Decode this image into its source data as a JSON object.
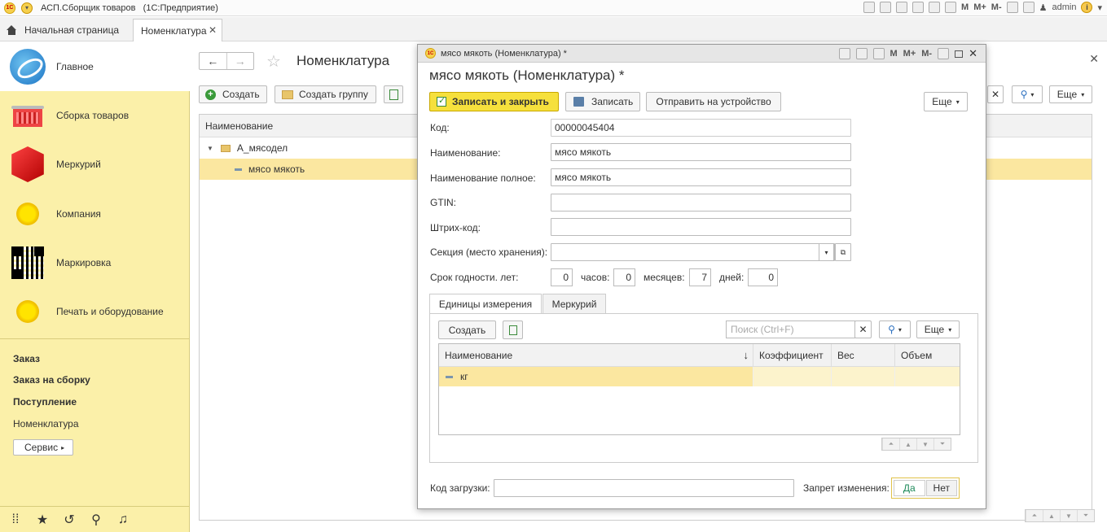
{
  "app": {
    "title": "АСП.Сборщик товаров   (1С:Предприятие)",
    "user": "admin",
    "tool_m": "M",
    "tool_mplus": "M+",
    "tool_mminus": "M-"
  },
  "tabs": {
    "home": "Начальная страница",
    "active": "Номенклатура"
  },
  "sidebar": {
    "sections": [
      {
        "label": "Главное",
        "icon": "globe-icon"
      },
      {
        "label": "Сборка товаров",
        "icon": "basket-icon"
      },
      {
        "label": "Меркурий",
        "icon": "cube-icon"
      },
      {
        "label": "Компания",
        "icon": "circle-icon"
      },
      {
        "label": "Маркировка",
        "icon": "qr-icon"
      },
      {
        "label": "Печать и оборудование",
        "icon": "circle-icon"
      }
    ],
    "links": [
      "Заказ",
      "Заказ на сборку",
      "Поступление",
      "Номенклатура"
    ],
    "service": "Сервис"
  },
  "list": {
    "title": "Номенклатура",
    "create": "Создать",
    "create_group": "Создать группу",
    "more": "Еще",
    "column": "Наименование",
    "group_row": "А_мясодел",
    "item_row": "мясо мякоть"
  },
  "dialog": {
    "window_title": "мясо мякоть (Номенклатура) *",
    "heading": "мясо мякоть (Номенклатура) *",
    "save_close": "Записать и закрыть",
    "save": "Записать",
    "send": "Отправить на устройство",
    "more": "Еще",
    "fields": {
      "code_label": "Код:",
      "code": "00000045404",
      "name_label": "Наименование:",
      "name": "мясо мякоть",
      "fullname_label": "Наименование полное:",
      "fullname": "мясо мякоть",
      "gtin_label": "GTIN:",
      "gtin": "",
      "barcode_label": "Штрих-код:",
      "barcode": "",
      "section_label": "Секция (место хранения):",
      "section": ""
    },
    "shelf": {
      "label": "Срок годности. лет:",
      "years": "0",
      "hours_label": "часов:",
      "hours": "0",
      "months_label": "месяцев:",
      "months": "7",
      "days_label": "дней:",
      "days": "0"
    },
    "tabs": [
      "Единицы измерения",
      "Меркурий"
    ],
    "units": {
      "create": "Создать",
      "search_placeholder": "Поиск (Ctrl+F)",
      "more": "Еще",
      "columns": [
        "Наименование",
        "Коэффициент",
        "Вес",
        "Объем"
      ],
      "rows": [
        {
          "name": "кг",
          "coef": "",
          "weight": "",
          "volume": ""
        }
      ]
    },
    "load_code_label": "Код загрузки:",
    "load_code": "",
    "lock_label": "Запрет изменения:",
    "lock_yes": "Да",
    "lock_no": "Нет"
  }
}
